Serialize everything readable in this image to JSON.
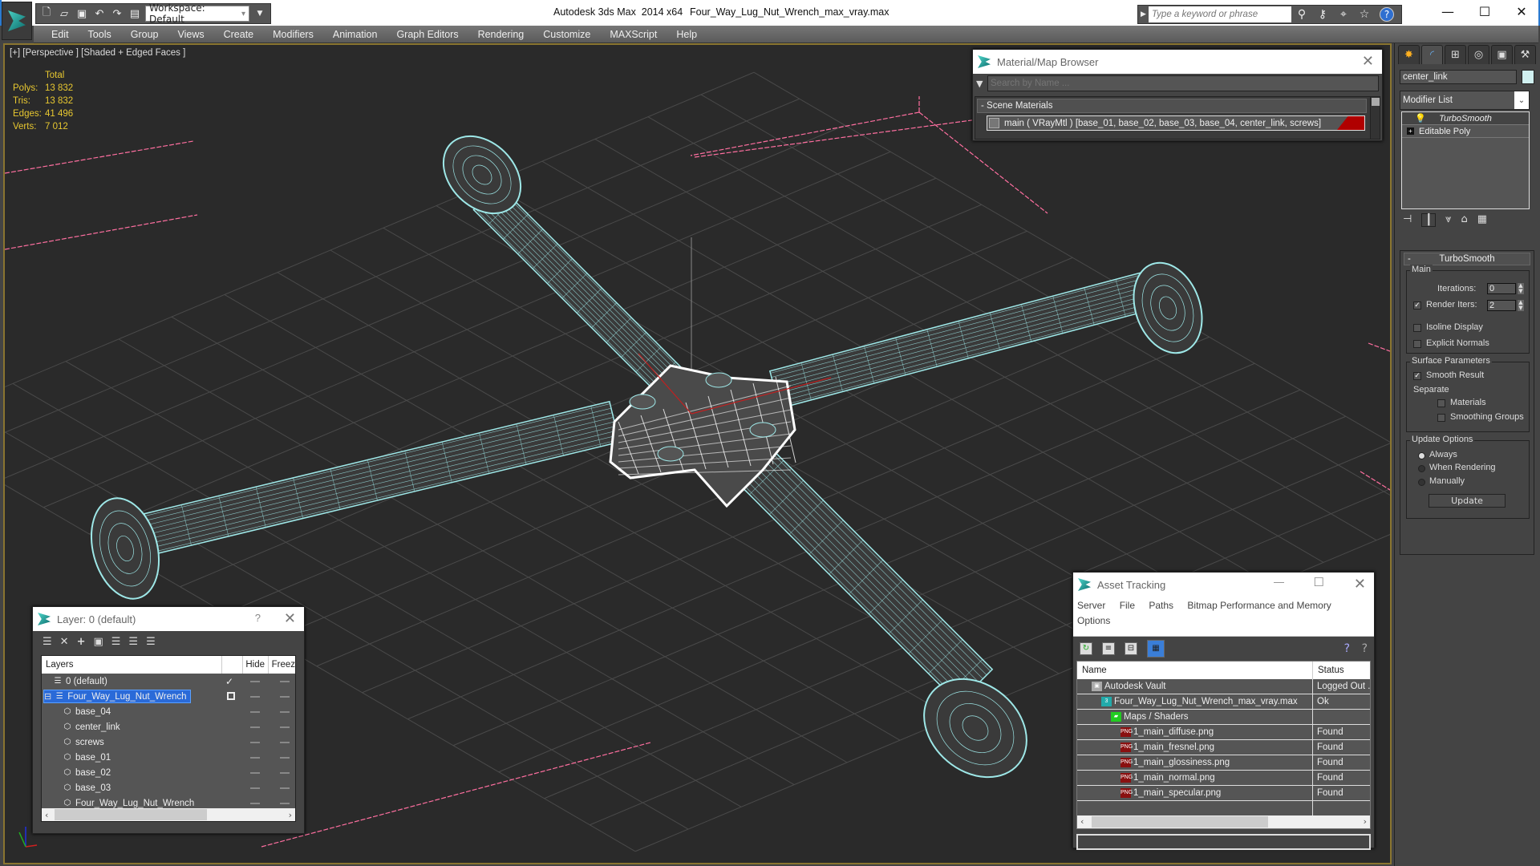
{
  "titlebar": {
    "app_title": "Autodesk 3ds Max  2014 x64",
    "file_title": "Four_Way_Lug_Nut_Wrench_max_vray.max",
    "workspace_label": "Workspace: Default",
    "help_search_placeholder": "Type a keyword or phrase",
    "window_controls": {
      "minimize": "—",
      "maximize": "☐",
      "close": "✕"
    }
  },
  "quick_access": [
    {
      "icon": "new-file-icon",
      "glyph": "🗋"
    },
    {
      "icon": "open-folder-icon",
      "glyph": "📂"
    },
    {
      "icon": "save-icon",
      "glyph": "💾"
    },
    {
      "icon": "undo-icon",
      "glyph": "↶"
    },
    {
      "icon": "redo-icon",
      "glyph": "↷"
    },
    {
      "icon": "project-folder-icon",
      "glyph": "▤"
    }
  ],
  "menu": [
    "Edit",
    "Tools",
    "Group",
    "Views",
    "Create",
    "Modifiers",
    "Animation",
    "Graph Editors",
    "Rendering",
    "Customize",
    "MAXScript",
    "Help"
  ],
  "viewport": {
    "label": "[+] [Perspective ] [Shaded + Edged Faces ]",
    "stats": {
      "header": "Total",
      "rows": [
        {
          "key": "Polys:",
          "value": "13 832"
        },
        {
          "key": "Tris:",
          "value": "13 832"
        },
        {
          "key": "Edges:",
          "value": "41 496"
        },
        {
          "key": "Verts:",
          "value": "7 012"
        }
      ]
    },
    "colors": {
      "wireframe": "#9ee8e8",
      "selected": "#ffffff",
      "grid": "#4a4a4a",
      "light_lines": "#ff6fa0",
      "stats_text": "#e8c830"
    }
  },
  "material_browser": {
    "title": "Material/Map Browser",
    "search_placeholder": "Search by Name ...",
    "group_label": "- Scene Materials",
    "item_label": "main  ( VRayMtl )  [base_01, base_02, base_03, base_04, center_link, screws]"
  },
  "command_panel": {
    "tabs": [
      {
        "icon": "create-icon",
        "glyph": "✸"
      },
      {
        "icon": "modify-icon",
        "glyph": "◜"
      },
      {
        "icon": "hierarchy-icon",
        "glyph": "⊞"
      },
      {
        "icon": "motion-icon",
        "glyph": "◎"
      },
      {
        "icon": "display-icon",
        "glyph": "▣"
      },
      {
        "icon": "utilities-icon",
        "glyph": "⚒"
      }
    ],
    "object_name": "center_link",
    "object_color": "#d0f0f0",
    "modifier_list_label": "Modifier List",
    "stack": [
      {
        "label": "TurboSmooth",
        "active": true
      },
      {
        "label": "Editable Poly",
        "active": false
      }
    ],
    "turbosmooth": {
      "title": "TurboSmooth",
      "main_group": "Main",
      "iterations_label": "Iterations:",
      "iterations_value": "0",
      "render_iters_label": "Render Iters:",
      "render_iters_value": "2",
      "render_iters_checked": true,
      "isoline_label": "Isoline Display",
      "isoline_checked": false,
      "explicit_normals_label": "Explicit Normals",
      "explicit_normals_checked": false,
      "surface_group": "Surface Parameters",
      "smooth_result_label": "Smooth Result",
      "smooth_result_checked": true,
      "separate_label": "Separate",
      "materials_label": "Materials",
      "materials_checked": false,
      "smoothing_groups_label": "Smoothing Groups",
      "smoothing_groups_checked": false,
      "update_group": "Update Options",
      "update_options": [
        "Always",
        "When Rendering",
        "Manually"
      ],
      "update_selected": "Always",
      "update_button": "Update"
    }
  },
  "layer_dialog": {
    "title": "Layer: 0 (default)",
    "help": "?",
    "columns": [
      "Layers",
      "",
      "Hide",
      "Freez"
    ],
    "rows": [
      {
        "name": "0 (default)",
        "type": "layer",
        "indent": 1,
        "current": true,
        "selected": false
      },
      {
        "name": "Four_Way_Lug_Nut_Wrench",
        "type": "layer",
        "indent": 0,
        "current": false,
        "selected": true,
        "expanded": true
      },
      {
        "name": "base_04",
        "type": "object",
        "indent": 2
      },
      {
        "name": "center_link",
        "type": "object",
        "indent": 2
      },
      {
        "name": "screws",
        "type": "object",
        "indent": 2
      },
      {
        "name": "base_01",
        "type": "object",
        "indent": 2
      },
      {
        "name": "base_02",
        "type": "object",
        "indent": 2
      },
      {
        "name": "base_03",
        "type": "object",
        "indent": 2
      },
      {
        "name": "Four_Way_Lug_Nut_Wrench",
        "type": "object",
        "indent": 2
      }
    ]
  },
  "asset_tracking": {
    "title": "Asset Tracking",
    "menu": [
      "Server",
      "File",
      "Paths",
      "Bitmap Performance and Memory",
      "Options"
    ],
    "columns": [
      "Name",
      "Status"
    ],
    "rows": [
      {
        "name": "Autodesk Vault",
        "status": "Logged Out ...",
        "icon": "vault-icon",
        "indent": 1
      },
      {
        "name": "Four_Way_Lug_Nut_Wrench_max_vray.max",
        "status": "Ok",
        "icon": "max-file-icon",
        "indent": 2
      },
      {
        "name": "Maps / Shaders",
        "status": "",
        "icon": "maps-icon",
        "indent": 3
      },
      {
        "name": "1_main_diffuse.png",
        "status": "Found",
        "icon": "png-icon",
        "indent": 4
      },
      {
        "name": "1_main_fresnel.png",
        "status": "Found",
        "icon": "png-icon",
        "indent": 4
      },
      {
        "name": "1_main_glossiness.png",
        "status": "Found",
        "icon": "png-icon",
        "indent": 4
      },
      {
        "name": "1_main_normal.png",
        "status": "Found",
        "icon": "png-icon",
        "indent": 4
      },
      {
        "name": "1_main_specular.png",
        "status": "Found",
        "icon": "png-icon",
        "indent": 4
      }
    ]
  }
}
